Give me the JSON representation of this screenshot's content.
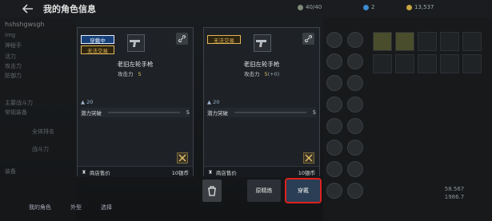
{
  "header": {
    "back_icon": "back-arrow-icon",
    "title": "我的角色信息"
  },
  "currency": [
    {
      "icon": "stamina-icon",
      "value": "40/40",
      "color": "#7e8b78"
    },
    {
      "icon": "gem-icon",
      "value": "2",
      "color": "#3c8bd0"
    },
    {
      "icon": "coin-icon",
      "value": "13,537",
      "color": "#c9a441"
    }
  ],
  "left_panel": {
    "char_name": "hshshgwsgh",
    "lines": [
      "img",
      "神秘手",
      "活力",
      "攻击力",
      "防御力",
      "主要战斗力",
      "常规装备",
      "全体排名",
      "战斗力",
      "装备"
    ]
  },
  "equipped_item": {
    "tags": [
      "穿戴中",
      "无法交易"
    ],
    "name": "老旧左轮手枪",
    "attack_label": "攻击力",
    "attack_value": "5",
    "level": "20",
    "potential_label": "潜力突破",
    "potential_value": "5",
    "sell_label": "商店售价",
    "sell_value": "10银币"
  },
  "compare_item": {
    "tags": [
      "无法交易"
    ],
    "name": "老旧左轮手枪",
    "attack_label": "攻击力",
    "attack_value": "5",
    "attack_bonus": "(+0)",
    "level": "20",
    "potential_label": "潜力突破",
    "potential_value": "5",
    "sell_label": "商店售价",
    "sell_value": "10银币"
  },
  "actions": {
    "decompose": "原精炼",
    "equip": "穿戴"
  },
  "bottom_bar": {
    "label_1": "我的角色",
    "label_2": "外型",
    "label_3": "选择"
  },
  "right_panel": {
    "power_1": "58.567",
    "power_2": "1986.7"
  }
}
